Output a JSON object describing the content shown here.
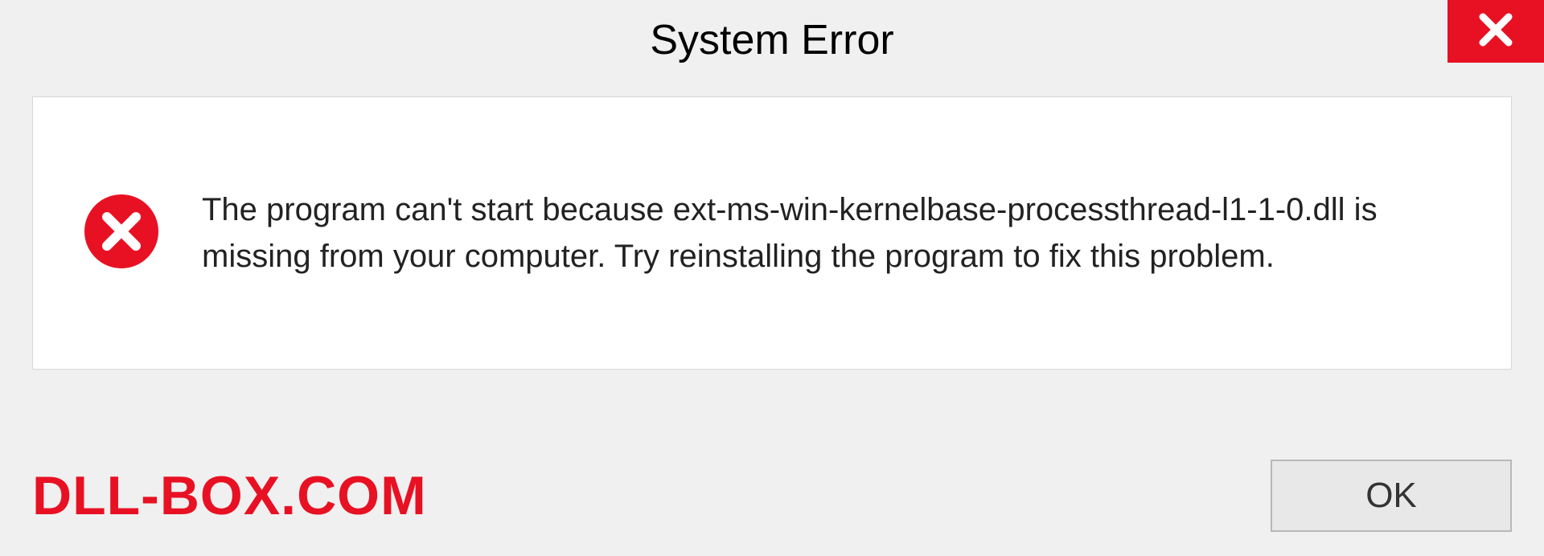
{
  "dialog": {
    "title": "System Error",
    "message": "The program can't start because ext-ms-win-kernelbase-processthread-l1-1-0.dll is missing from your computer. Try reinstalling the program to fix this problem.",
    "ok_label": "OK"
  },
  "watermark": "DLL-BOX.COM"
}
